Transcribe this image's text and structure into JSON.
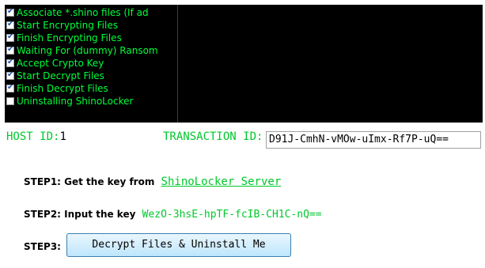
{
  "checklist": [
    {
      "label": "Associate *.shino files (If ad",
      "checked": true
    },
    {
      "label": "Start  Encrypting Files",
      "checked": true
    },
    {
      "label": "Finish Encrypting Files",
      "checked": true
    },
    {
      "label": "Waiting For (dummy) Ransom",
      "checked": true
    },
    {
      "label": "Accept Crypto Key",
      "checked": true
    },
    {
      "label": "Start Decrypt Files",
      "checked": true
    },
    {
      "label": "Finish Decrypt Files",
      "checked": true
    },
    {
      "label": "Uninstalling ShinoLocker",
      "checked": false
    }
  ],
  "host": {
    "label": "HOST ID:",
    "value": "1"
  },
  "transaction": {
    "label": "TRANSACTION ID:",
    "value": "D91J-CmhN-vMOw-uImx-Rf7P-uQ=="
  },
  "steps": {
    "step1_label": "STEP1:",
    "step1_text": "Get the key from",
    "step1_link": "ShinoLocker Server",
    "step2_label": "STEP2:",
    "step2_text": "Input the key",
    "step2_key": "WezO-3hsE-hpTF-fcIB-CH1C-nQ==",
    "step3_label": "STEP3:",
    "step3_button": "Decrypt Files & Uninstall Me"
  },
  "colors": {
    "accent_green": "#00c82c",
    "console_bg": "#000000",
    "console_text": "#00ff3a"
  }
}
